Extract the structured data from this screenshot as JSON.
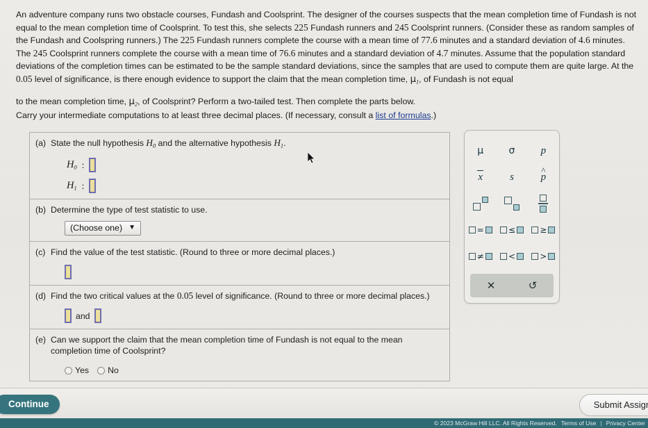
{
  "problem": {
    "p1_a": "An adventure company runs two obstacle courses, Fundash and Coolsprint. The designer of the courses suspects that the mean completion time of Fundash is not equal to the mean completion time of Coolsprint. To test this, she selects ",
    "n1": "225",
    "p1_b": " Fundash runners and ",
    "n2": "245",
    "p1_c": " Coolsprint runners. (Consider these as random samples of the Fundash and Coolspring runners.) The ",
    "n3": "225",
    "p1_d": " Fundash runners complete the course with a mean time of ",
    "n4": "77.6",
    "p1_e": " minutes and a standard deviation of ",
    "n5": "4.6",
    "p1_f": " minutes. The ",
    "n6": "245",
    "p1_g": " Coolsprint runners complete the course with a mean time of ",
    "n7": "76.6",
    "p1_h": " minutes and a standard deviation of ",
    "n8": "4.7",
    "p1_i": " minutes. Assume that the population standard deviations of the completion times can be estimated to be the sample standard deviations, since the samples that are used to compute them are quite large. At the ",
    "n9": "0.05",
    "p1_j": " level of significance, is there enough evidence to support the claim that the mean completion time, ",
    "mu1": "μ",
    "mu1_sub": "1",
    "p1_k": ", of Fundash is not equal",
    "p2_a": "to the mean completion time, ",
    "mu2": "μ",
    "mu2_sub": "2",
    "p2_b": ", of Coolsprint? Perform a two-tailed test. Then complete the parts below."
  },
  "instructions": {
    "before_link": "Carry your intermediate computations to at least three decimal places. (If necessary, consult a ",
    "link_text": "list of formulas",
    "after_link": ".)"
  },
  "parts": {
    "a": {
      "letter": "(a)",
      "text_1": "State the null hypothesis ",
      "h0": "H",
      "h0_sub": "0",
      "text_2": " and the alternative hypothesis ",
      "h1": "H",
      "h1_sub": "1",
      "text_3": ".",
      "row0_label": "H",
      "row0_sub": "0",
      "row0_colon": ":",
      "row1_label": "H",
      "row1_sub": "1",
      "row1_colon": ":"
    },
    "b": {
      "letter": "(b)",
      "text": "Determine the type of test statistic to use.",
      "dropdown_value": "(Choose one)",
      "caret": "▼"
    },
    "c": {
      "letter": "(c)",
      "text": "Find the value of the test statistic. (Round to three or more decimal places.)"
    },
    "d": {
      "letter": "(d)",
      "text_1": "Find the two critical values at the ",
      "level": "0.05",
      "text_2": " level of significance. (Round to three or more decimal places.)",
      "and_label": "and"
    },
    "e": {
      "letter": "(e)",
      "text": "Can we support the claim that the mean completion time of Fundash is not equal to the mean completion time of Coolsprint?",
      "option_yes": "Yes",
      "option_no": "No"
    }
  },
  "palette": {
    "row1": [
      {
        "name": "mu-symbol",
        "glyph": "μ"
      },
      {
        "name": "sigma-symbol",
        "glyph": "σ"
      },
      {
        "name": "p-symbol",
        "glyph": "p"
      }
    ],
    "row2": [
      {
        "name": "x-bar-symbol",
        "glyph": "x"
      },
      {
        "name": "s-symbol",
        "glyph": "s"
      },
      {
        "name": "p-hat-symbol",
        "glyph": "p"
      }
    ],
    "row3": [
      {
        "name": "superscript-template",
        "glyph": ""
      },
      {
        "name": "subscript-template",
        "glyph": ""
      },
      {
        "name": "fraction-template",
        "glyph": ""
      }
    ],
    "row4": [
      {
        "name": "equals-template",
        "glyph": "="
      },
      {
        "name": "less-equal-template",
        "glyph": "≤"
      },
      {
        "name": "greater-equal-template",
        "glyph": "≥"
      }
    ],
    "row5": [
      {
        "name": "not-equal-template",
        "glyph": "≠"
      },
      {
        "name": "less-than-template",
        "glyph": "<"
      },
      {
        "name": "greater-than-template",
        "glyph": ">"
      }
    ],
    "clear_glyph": "✕",
    "undo_glyph": "↺"
  },
  "bottom": {
    "continue_label": "Continue",
    "submit_label": "Submit Assignment"
  },
  "footer": {
    "copyright": "© 2023 McGraw Hill LLC. All Rights Reserved.",
    "terms": "Terms of Use",
    "separator": "|",
    "privacy": "Privacy Center"
  },
  "colors": {
    "teal": "#34737d",
    "input_fill": "#ece09c",
    "input_border": "#6d6dae",
    "footer_bg": "#2f6a74"
  }
}
